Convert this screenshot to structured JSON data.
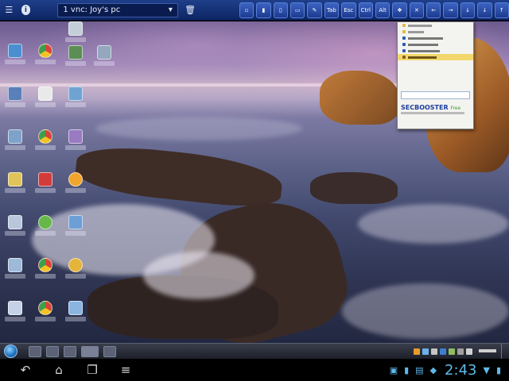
{
  "toolbar": {
    "session_label": "1 vnc: Joy's pc",
    "buttons": [
      "Tab",
      "Esc",
      "Ctrl",
      "Alt"
    ],
    "icons": [
      "menu-icon",
      "info-icon",
      "trash-icon",
      "clipboard-icon",
      "copy-icon",
      "paste-icon",
      "document-icon",
      "brush-icon",
      "windows-key-icon",
      "fullscreen-icon",
      "arrow-left-icon",
      "arrow-right-icon",
      "arrow-down-icon",
      "arrow-down-2-icon",
      "arrow-up-icon"
    ]
  },
  "popup": {
    "search_value": "",
    "brand": "SECBOOSTER",
    "brand_suffix": "Free"
  },
  "colors": {
    "toolbar_top": "#1f3f8a",
    "accent_blue": "#5fb9e8",
    "selected_row": "#f2d86c"
  },
  "android": {
    "clock": "2:43"
  }
}
